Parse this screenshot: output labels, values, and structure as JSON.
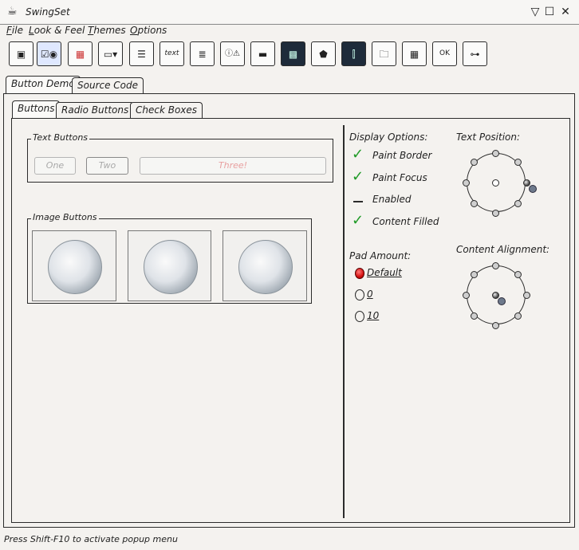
{
  "window": {
    "title": "SwingSet",
    "minimize": "▽",
    "maximize": "☐",
    "close": "✕"
  },
  "menu": [
    {
      "label": "File"
    },
    {
      "label": "Look & Feel"
    },
    {
      "label": "Themes"
    },
    {
      "label": "Options"
    }
  ],
  "toolbar": {
    "items": [
      {
        "name": "internal-frame"
      },
      {
        "name": "checkbox-radio"
      },
      {
        "name": "color-chooser"
      },
      {
        "name": "combobox"
      },
      {
        "name": "file-chooser"
      },
      {
        "name": "html",
        "glyph": "text"
      },
      {
        "name": "list"
      },
      {
        "name": "option-pane"
      },
      {
        "name": "progress-bar"
      },
      {
        "name": "scroll-pane"
      },
      {
        "name": "slider"
      },
      {
        "name": "split-pane"
      },
      {
        "name": "tabbed-pane"
      },
      {
        "name": "table"
      },
      {
        "name": "tooltip",
        "glyph": "OK"
      },
      {
        "name": "tree"
      }
    ]
  },
  "outer_tabs": [
    {
      "label": "Button Demo"
    },
    {
      "label": "Source Code"
    }
  ],
  "inner_tabs": [
    {
      "label": "Buttons"
    },
    {
      "label": "Radio Buttons"
    },
    {
      "label": "Check Boxes"
    }
  ],
  "text_buttons": {
    "title": "Text Buttons",
    "buttons": [
      {
        "label": "One"
      },
      {
        "label": "Two"
      },
      {
        "label": "Three!"
      }
    ]
  },
  "image_buttons": {
    "title": "Image Buttons"
  },
  "display_options": {
    "title": "Display Options:",
    "items": [
      {
        "label": "Paint Border",
        "checked": true
      },
      {
        "label": "Paint Focus",
        "checked": true
      },
      {
        "label": "Enabled",
        "checked": false
      },
      {
        "label": "Content Filled",
        "checked": true
      }
    ]
  },
  "pad_amount": {
    "title": "Pad Amount:",
    "options": [
      {
        "label": "Default",
        "selected": true
      },
      {
        "label": "0",
        "selected": false
      },
      {
        "label": "10",
        "selected": false
      }
    ]
  },
  "text_position": {
    "title": "Text Position:"
  },
  "content_alignment": {
    "title": "Content Alignment:"
  },
  "status": {
    "text": "Press Shift-F10 to activate popup menu"
  },
  "colors": {
    "check": "#1f9a26",
    "radio_selected": "#d41010",
    "line": "#2b2b2b"
  }
}
